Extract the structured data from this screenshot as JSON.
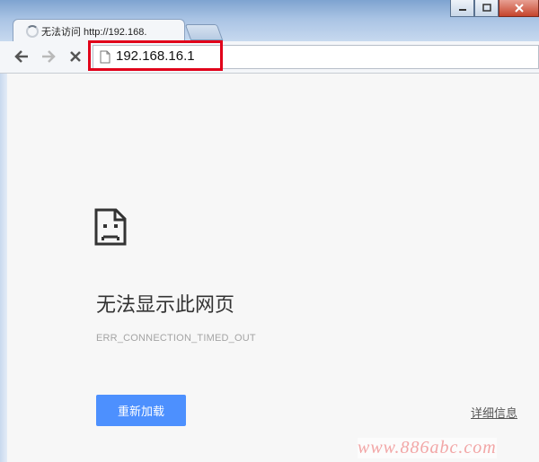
{
  "tab": {
    "title": "无法访问 http://192.168."
  },
  "address_bar": {
    "url": "192.168.16.1"
  },
  "error_page": {
    "title": "无法显示此网页",
    "code": "ERR_CONNECTION_TIMED_OUT",
    "reload_label": "重新加载",
    "details_label": "详细信息"
  },
  "watermark": "www.886abc.com",
  "colors": {
    "reload_button": "#4d90fe",
    "highlight_box": "#e1001a",
    "page_background": "#f7f7f7"
  }
}
